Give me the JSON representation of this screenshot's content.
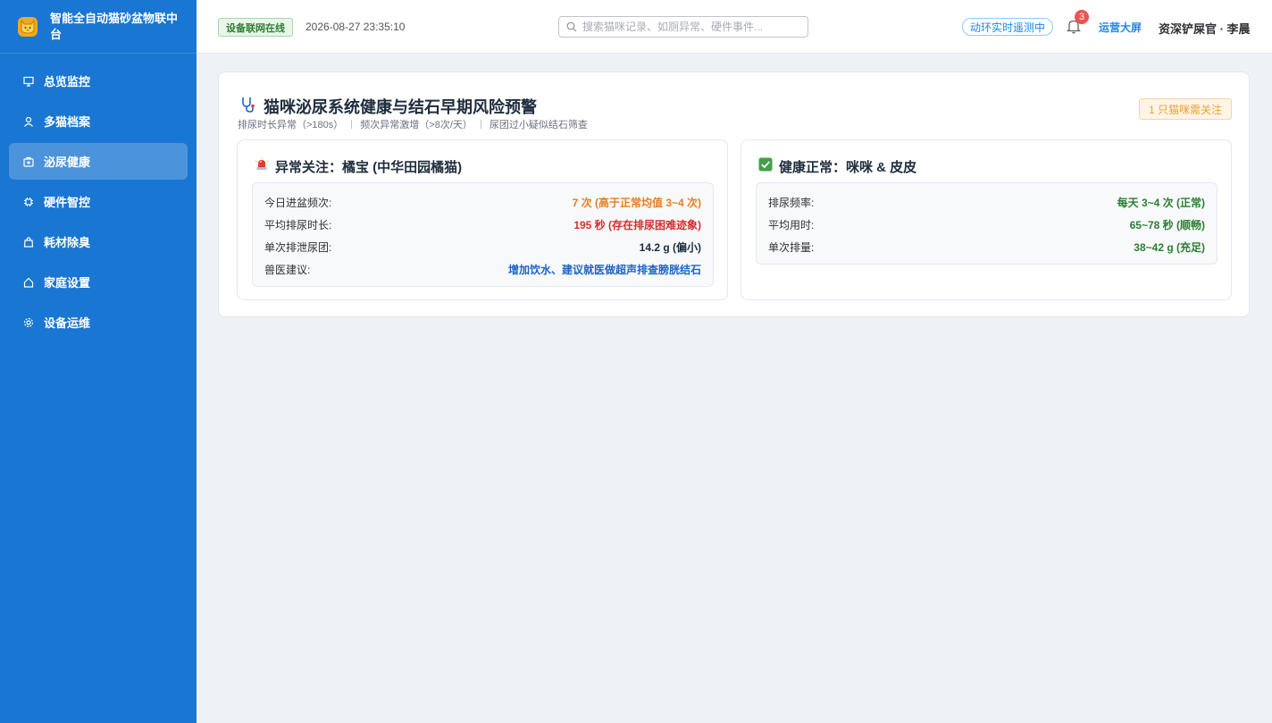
{
  "brand": {
    "title": "智能全自动猫砂盆物联中台"
  },
  "menu": [
    {
      "label": "总览监控",
      "icon": "monitor-icon",
      "active": false
    },
    {
      "label": "多猫档案",
      "icon": "user-icon",
      "active": false
    },
    {
      "label": "泌尿健康",
      "icon": "medical-kit-icon",
      "active": true
    },
    {
      "label": "硬件智控",
      "icon": "chip-icon",
      "active": false
    },
    {
      "label": "耗材除臭",
      "icon": "bag-icon",
      "active": false
    },
    {
      "label": "家庭设置",
      "icon": "home-icon",
      "active": false
    },
    {
      "label": "设备运维",
      "icon": "gear-icon",
      "active": false
    }
  ],
  "header": {
    "status": "设备联网在线",
    "datetime": "2026-08-27 23:35:10",
    "search_placeholder": "搜索猫咪记录、如厕异常、硬件事件...",
    "live_tag": "动环实时遥测中",
    "notification_count": "3",
    "screen_link": "运营大屏",
    "user": "资深铲屎官 · 李晨"
  },
  "card": {
    "title": "猫咪泌尿系统健康与结石早期风险预警",
    "criteria": [
      "排尿时长异常（>180s）",
      "频次异常激增（>8次/天）",
      "尿团过小疑似结石筛查"
    ],
    "alert_tag": "1 只猫咪需关注",
    "abnormal": {
      "title": "异常关注：橘宝 (中华田园橘猫)",
      "rows": [
        {
          "k": "今日进盆频次:",
          "v": "7 次 (高于正常均值 3~4 次)",
          "color": "#e67e22"
        },
        {
          "k": "平均排尿时长:",
          "v": "195 秒 (存在排尿困难迹象)",
          "color": "#d32f2f"
        },
        {
          "k": "单次排泄尿团:",
          "v": "14.2 g (偏小)",
          "color": "#1f2d3d"
        },
        {
          "k": "兽医建议:",
          "v": "增加饮水、建议就医做超声排查膀胱结石",
          "color": "#1e63c9"
        }
      ]
    },
    "normal": {
      "title": "健康正常：咪咪 & 皮皮",
      "rows": [
        {
          "k": "排尿频率:",
          "v": "每天 3~4 次 (正常)",
          "color": "#2e7d32"
        },
        {
          "k": "平均用时:",
          "v": "65~78 秒 (顺畅)",
          "color": "#2e7d32"
        },
        {
          "k": "单次排量:",
          "v": "38~42 g (充足)",
          "color": "#2e7d32"
        }
      ]
    }
  }
}
